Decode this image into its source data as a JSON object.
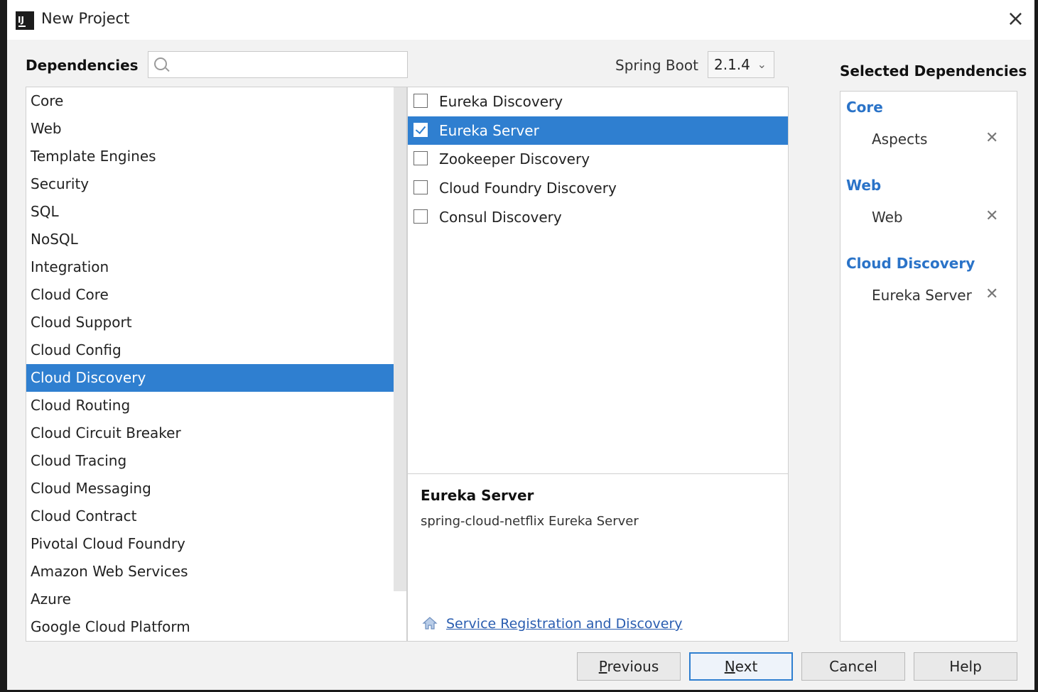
{
  "window": {
    "title": "New Project",
    "close_glyph": "×"
  },
  "search": {
    "label": "Dependencies",
    "value": "",
    "placeholder": ""
  },
  "spring_boot": {
    "label": "Spring Boot",
    "version": "2.1.4"
  },
  "categories": [
    "Core",
    "Web",
    "Template Engines",
    "Security",
    "SQL",
    "NoSQL",
    "Integration",
    "Cloud Core",
    "Cloud Support",
    "Cloud Config",
    "Cloud Discovery",
    "Cloud Routing",
    "Cloud Circuit Breaker",
    "Cloud Tracing",
    "Cloud Messaging",
    "Cloud Contract",
    "Pivotal Cloud Foundry",
    "Amazon Web Services",
    "Azure",
    "Google Cloud Platform"
  ],
  "selected_category": "Cloud Discovery",
  "dependencies": [
    {
      "label": "Eureka Discovery",
      "checked": false
    },
    {
      "label": "Eureka Server",
      "checked": true
    },
    {
      "label": "Zookeeper Discovery",
      "checked": false
    },
    {
      "label": "Cloud Foundry Discovery",
      "checked": false
    },
    {
      "label": "Consul Discovery",
      "checked": false
    }
  ],
  "selected_dependency": "Eureka Server",
  "description": {
    "title": "Eureka Server",
    "body": "spring-cloud-netflix Eureka Server",
    "link": "Service Registration and Discovery"
  },
  "selected_dependencies": {
    "title": "Selected Dependencies",
    "groups": [
      {
        "name": "Core",
        "items": [
          "Aspects"
        ]
      },
      {
        "name": "Web",
        "items": [
          "Web"
        ]
      },
      {
        "name": "Cloud Discovery",
        "items": [
          "Eureka Server"
        ]
      }
    ]
  },
  "buttons": {
    "previous": {
      "mnemonic": "P",
      "rest": "revious"
    },
    "next": {
      "mnemonic": "N",
      "rest": "ext"
    },
    "cancel": "Cancel",
    "help": "Help"
  },
  "colors": {
    "selection": "#2f7fd0",
    "group_title": "#2a73c8",
    "link": "#2a5db0"
  },
  "icons": {
    "app": "intellij-icon",
    "search": "search-icon",
    "link": "home-icon",
    "remove": "close-icon"
  }
}
